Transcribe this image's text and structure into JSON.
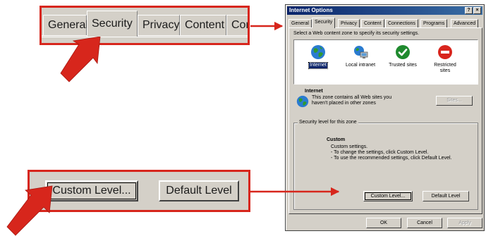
{
  "zoom_tabs": {
    "tabs": [
      "General",
      "Security",
      "Privacy",
      "Content",
      "Conn"
    ],
    "active": "Security"
  },
  "zoom_buttons": {
    "custom_label": "Custom Level...",
    "default_label": "Default Level"
  },
  "dialog": {
    "title": "Internet Options",
    "help_glyph": "?",
    "close_glyph": "×",
    "tabs": [
      "General",
      "Security",
      "Privacy",
      "Content",
      "Connections",
      "Programs",
      "Advanced"
    ],
    "active_tab": "Security",
    "instruction": "Select a Web content zone to specify its security settings.",
    "zones": [
      {
        "label": "Internet",
        "icon": "globe-icon",
        "selected": true
      },
      {
        "label": "Local intranet",
        "icon": "intranet-icon",
        "selected": false
      },
      {
        "label": "Trusted sites",
        "icon": "checkmark-icon",
        "selected": false
      },
      {
        "label_line1": "Restricted",
        "label_line2": "sites",
        "icon": "restricted-icon",
        "selected": false
      }
    ],
    "zone_info": {
      "title": "Internet",
      "description_line1": "This zone contains all Web sites you",
      "description_line2": "haven't placed in other zones",
      "sites_label": "Sites..."
    },
    "security_level": {
      "legend": "Security level for this zone",
      "title": "Custom",
      "lines": [
        "Custom settings.",
        "- To change the settings, click Custom Level.",
        "- To use the recommended settings, click Default Level."
      ],
      "custom_level_label": "Custom Level...",
      "default_level_label": "Default Level"
    },
    "footer": {
      "ok": "OK",
      "cancel": "Cancel",
      "apply": "Apply"
    }
  },
  "colors": {
    "callout_red": "#d7261c",
    "window_gray": "#d4d0c8",
    "titlebar_start": "#0a246a",
    "titlebar_end": "#3a6ea5"
  }
}
